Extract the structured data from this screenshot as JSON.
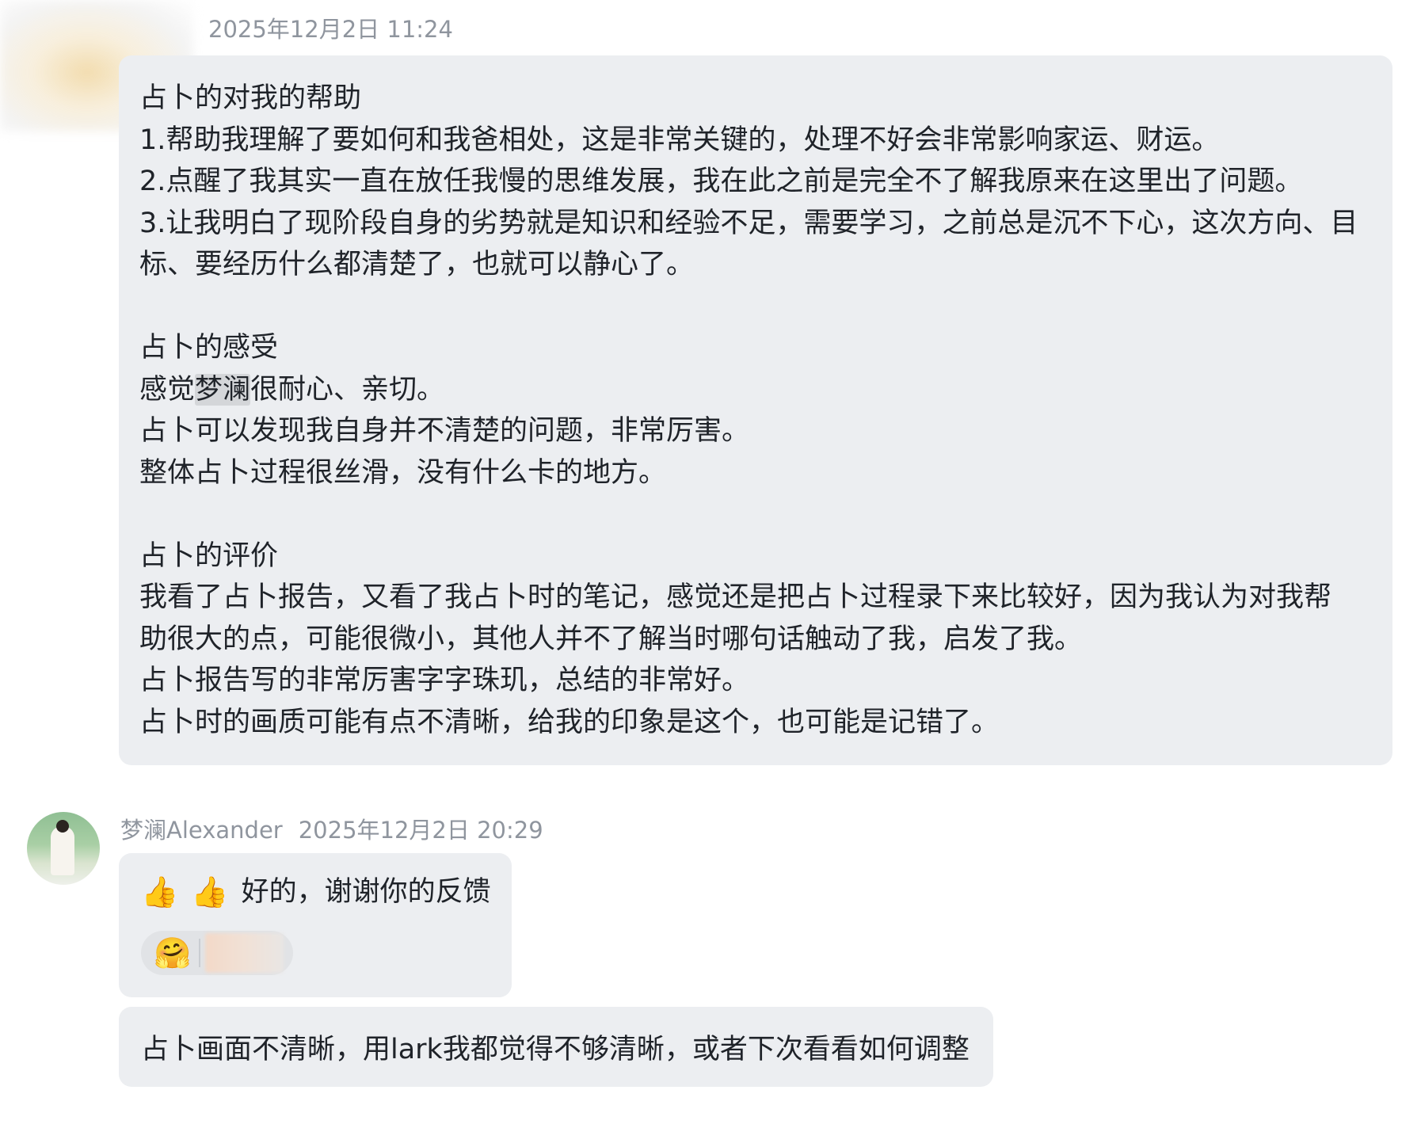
{
  "messages": [
    {
      "timestamp": "2025年12月2日 11:24",
      "lines": [
        "占卜的对我的帮助",
        "1.帮助我理解了要如何和我爸相处，这是非常关键的，处理不好会非常影响家运、财运。",
        "2.点醒了我其实一直在放任我慢的思维发展，我在此之前是完全不了解我原来在这里出了问题。",
        "3.让我明白了现阶段自身的劣势就是知识和经验不足，需要学习，之前总是沉不下心，这次方向、目",
        "标、要经历什么都清楚了，也就可以静心了。",
        "",
        "占卜的感受",
        "感觉",
        "占卜可以发现我自身并不清楚的问题，非常厉害。",
        "整体占卜过程很丝滑，没有什么卡的地方。",
        "",
        "占卜的评价",
        "我看了占卜报告，又看了我占卜时的笔记，感觉还是把占卜过程录下来比较好，因为我认为对我帮",
        "助很大的点，可能很微小，其他人并不了解当时哪句话触动了我，启发了我。",
        "占卜报告写的非常厉害字字珠玑，总结的非常好。",
        "占卜时的画质可能有点不清晰，给我的印象是这个，也可能是记错了。"
      ],
      "feeling_line": {
        "prefix": "感觉",
        "highlight": "梦澜",
        "suffix": "很耐心、亲切。"
      }
    },
    {
      "sender": "梦澜Alexander",
      "timestamp": "2025年12月2日 20:29",
      "reply_emojis": [
        "👍",
        "👍"
      ],
      "reply_text": "好的，谢谢你的反馈",
      "reaction_emoji": "🤗"
    },
    {
      "text": "占卜画面不清晰，用lark我都觉得不够清晰，或者下次看看如何调整"
    }
  ]
}
